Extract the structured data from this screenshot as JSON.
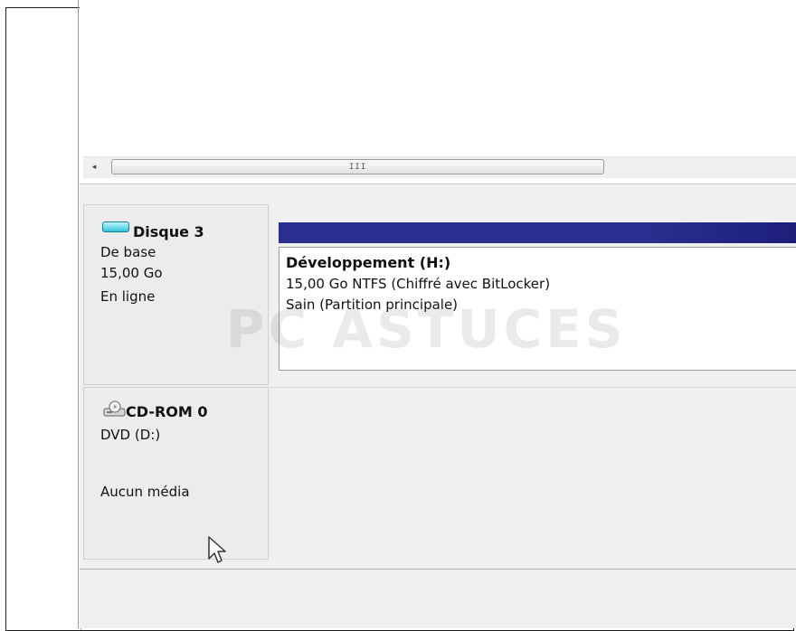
{
  "scrollbar": {
    "grip": "III",
    "left_arrow": "◂"
  },
  "disk": {
    "name": "Disque 3",
    "type": "De base",
    "size": "15,00 Go",
    "status": "En ligne",
    "icon": "disk-drive-icon",
    "partition": {
      "name": "Développement  (H:)",
      "detail": "15,00 Go NTFS (Chiffré avec BitLocker)",
      "health": "Sain (Partition principale)",
      "bar_color": "#2b2f8f"
    }
  },
  "cdrom": {
    "name": "CD-ROM 0",
    "drive": "DVD (D:)",
    "media": "Aucun média",
    "icon": "cd-drive-icon"
  },
  "watermark": "PC ASTUCES"
}
